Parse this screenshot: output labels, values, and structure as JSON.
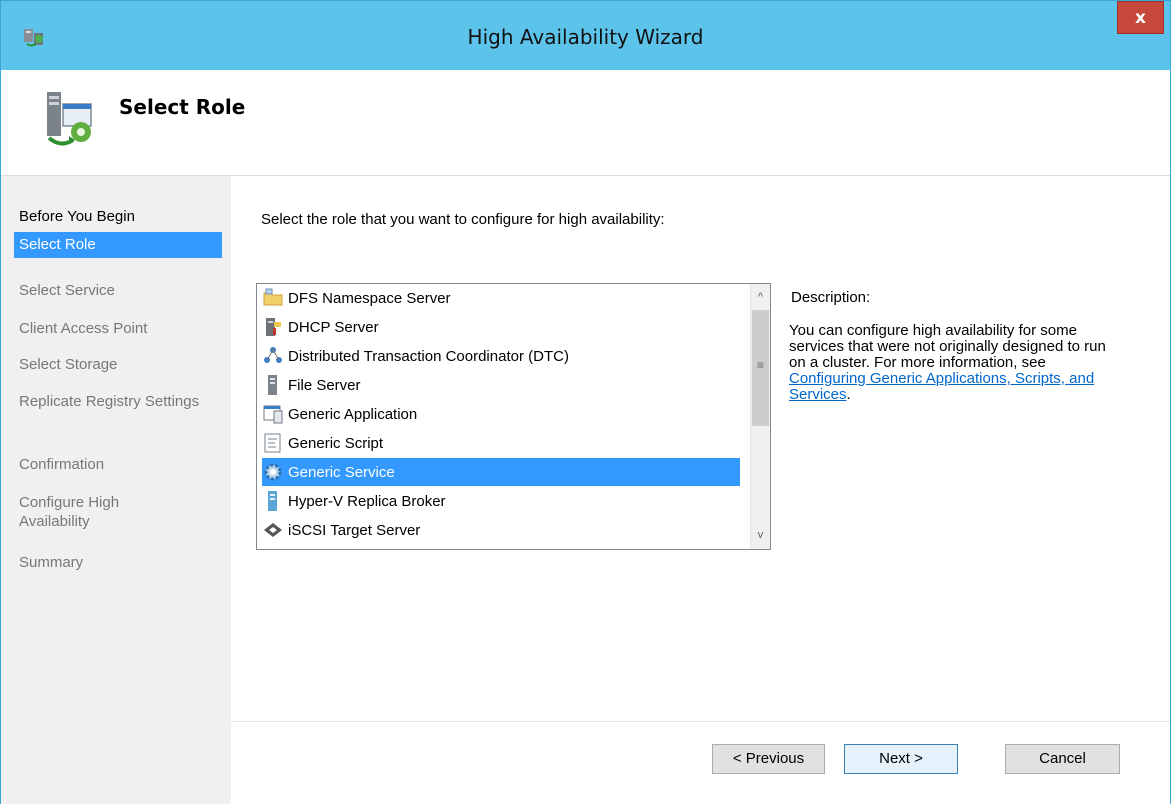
{
  "window": {
    "title": "High Availability Wizard",
    "close_glyph": "x"
  },
  "header": {
    "title": "Select Role",
    "icon": "cluster-server-icon"
  },
  "steps": [
    {
      "label": "Before You Begin",
      "state": "enabled"
    },
    {
      "label": "Select Role",
      "state": "selected"
    },
    {
      "label": "Select Service",
      "state": "disabled"
    },
    {
      "label": "Client Access Point",
      "state": "disabled"
    },
    {
      "label": "Select Storage",
      "state": "disabled"
    },
    {
      "label": "Replicate Registry Settings",
      "state": "disabled"
    },
    {
      "label": "Confirmation",
      "state": "disabled"
    },
    {
      "label": "Configure High Availability",
      "state": "disabled"
    },
    {
      "label": "Summary",
      "state": "disabled"
    }
  ],
  "main": {
    "prompt": "Select the role that you want to configure for high availability:",
    "roles": [
      {
        "label": "DFS Namespace Server",
        "icon": "folder-icon"
      },
      {
        "label": "DHCP Server",
        "icon": "dhcp-server-icon"
      },
      {
        "label": "Distributed Transaction Coordinator (DTC)",
        "icon": "dtc-icon"
      },
      {
        "label": "File Server",
        "icon": "file-server-icon"
      },
      {
        "label": "Generic Application",
        "icon": "application-window-icon"
      },
      {
        "label": "Generic Script",
        "icon": "script-icon"
      },
      {
        "label": "Generic Service",
        "icon": "gear-icon",
        "selected": true
      },
      {
        "label": "Hyper-V Replica Broker",
        "icon": "server-tower-icon"
      },
      {
        "label": "iSCSI Target Server",
        "icon": "iscsi-target-icon"
      }
    ],
    "scroll": {
      "up_glyph": "^",
      "down_glyph": "v",
      "grip_glyph": "≡"
    },
    "description": {
      "heading": "Description:",
      "text": "You can configure high availability for some services that were not originally designed to run on a cluster. For more information, see ",
      "link": "Configuring Generic Applications, Scripts, and Services",
      "suffix": "."
    }
  },
  "buttons": {
    "previous": "< Previous",
    "next": "Next >",
    "cancel": "Cancel"
  },
  "colors": {
    "titlebar": "#5cc4ea",
    "selection": "#3399ff",
    "close": "#c7473a",
    "link": "#0066cc"
  }
}
